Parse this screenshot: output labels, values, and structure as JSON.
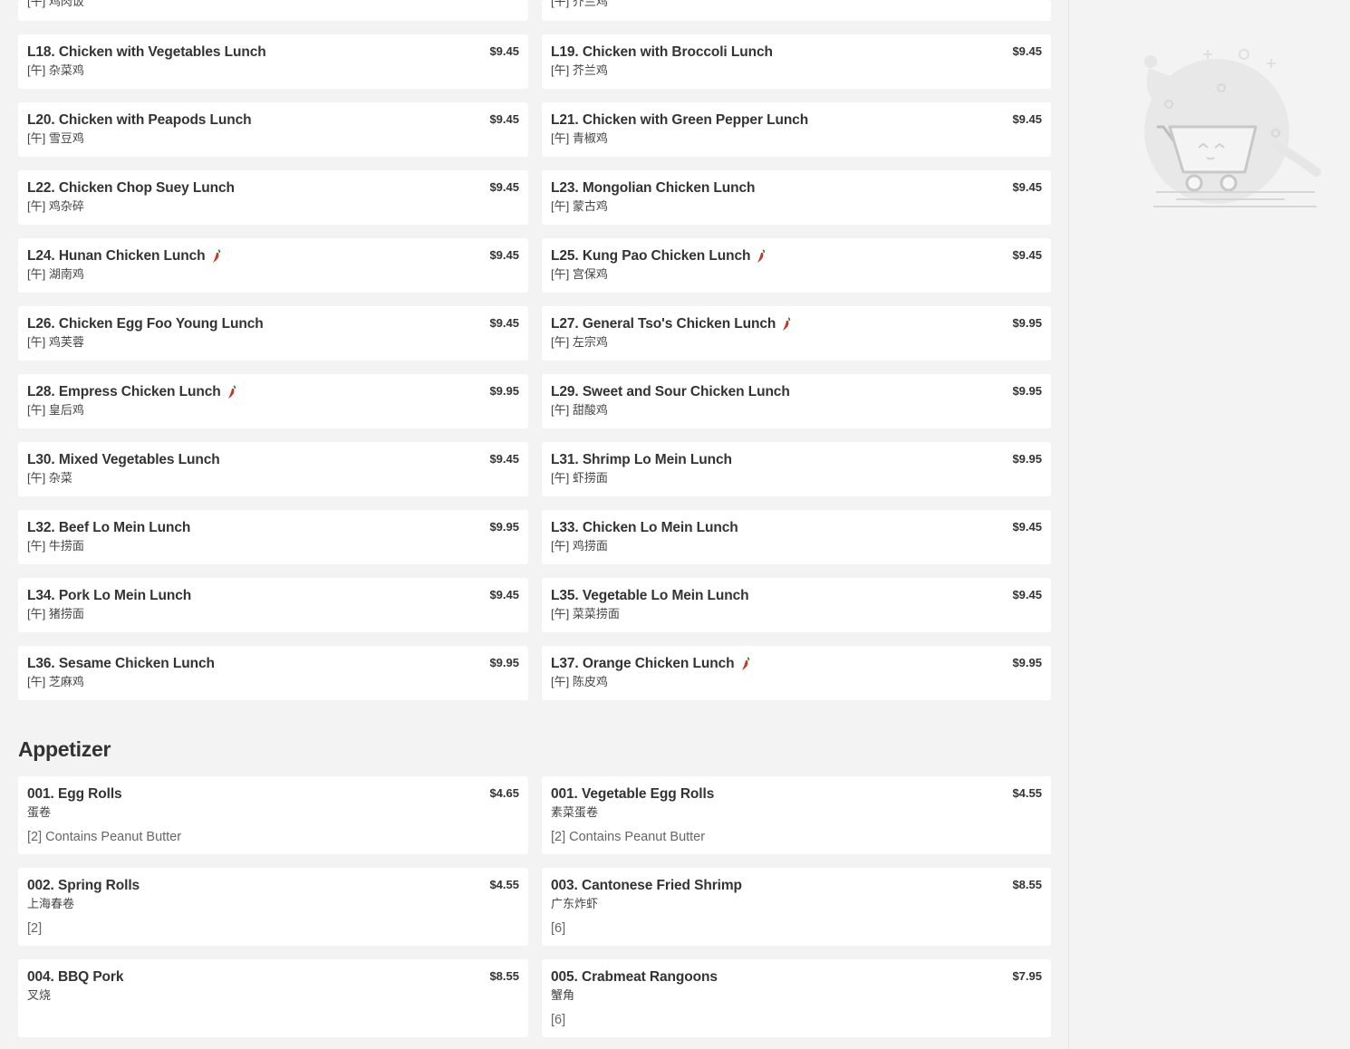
{
  "top_partial": [
    {
      "sub": "[午] 鸡肉饭"
    },
    {
      "sub": "[午] 芥兰鸡"
    }
  ],
  "lunch_items": [
    {
      "name": "L18. Chicken with Vegetables Lunch",
      "price": "$9.45",
      "sub": "[午] 杂菜鸡",
      "spicy": false
    },
    {
      "name": "L19. Chicken with Broccoli Lunch",
      "price": "$9.45",
      "sub": "[午] 芥兰鸡",
      "spicy": false
    },
    {
      "name": "L20. Chicken with Peapods Lunch",
      "price": "$9.45",
      "sub": "[午] 雪豆鸡",
      "spicy": false
    },
    {
      "name": "L21. Chicken with Green Pepper Lunch",
      "price": "$9.45",
      "sub": "[午] 青椒鸡",
      "spicy": false
    },
    {
      "name": "L22. Chicken Chop Suey Lunch",
      "price": "$9.45",
      "sub": "[午] 鸡杂碎",
      "spicy": false
    },
    {
      "name": "L23. Mongolian Chicken Lunch",
      "price": "$9.45",
      "sub": "[午] 蒙古鸡",
      "spicy": false
    },
    {
      "name": "L24. Hunan Chicken Lunch",
      "price": "$9.45",
      "sub": "[午] 湖南鸡",
      "spicy": true
    },
    {
      "name": "L25. Kung Pao Chicken Lunch",
      "price": "$9.45",
      "sub": "[午] 宫保鸡",
      "spicy": true
    },
    {
      "name": "L26. Chicken Egg Foo Young Lunch",
      "price": "$9.45",
      "sub": "[午] 鸡芙蓉",
      "spicy": false
    },
    {
      "name": "L27. General Tso's Chicken Lunch",
      "price": "$9.95",
      "sub": "[午] 左宗鸡",
      "spicy": true
    },
    {
      "name": "L28. Empress Chicken Lunch",
      "price": "$9.95",
      "sub": "[午] 皇后鸡",
      "spicy": true
    },
    {
      "name": "L29. Sweet and Sour Chicken Lunch",
      "price": "$9.95",
      "sub": "[午] 甜酸鸡",
      "spicy": false
    },
    {
      "name": "L30. Mixed Vegetables Lunch",
      "price": "$9.45",
      "sub": "[午] 杂菜",
      "spicy": false
    },
    {
      "name": "L31. Shrimp Lo Mein Lunch",
      "price": "$9.95",
      "sub": "[午] 虾捞面",
      "spicy": false
    },
    {
      "name": "L32. Beef Lo Mein Lunch",
      "price": "$9.95",
      "sub": "[午] 牛捞面",
      "spicy": false
    },
    {
      "name": "L33. Chicken Lo Mein Lunch",
      "price": "$9.45",
      "sub": "[午] 鸡捞面",
      "spicy": false
    },
    {
      "name": "L34. Pork Lo Mein Lunch",
      "price": "$9.45",
      "sub": "[午] 猪捞面",
      "spicy": false
    },
    {
      "name": "L35. Vegetable Lo Mein Lunch",
      "price": "$9.45",
      "sub": "[午] 菜菜捞面",
      "spicy": false
    },
    {
      "name": "L36. Sesame Chicken Lunch",
      "price": "$9.95",
      "sub": "[午] 芝麻鸡",
      "spicy": false
    },
    {
      "name": "L37. Orange Chicken Lunch",
      "price": "$9.95",
      "sub": "[午] 陈皮鸡",
      "spicy": true
    }
  ],
  "appetizer": {
    "title": "Appetizer",
    "items": [
      {
        "name": "001. Egg Rolls",
        "price": "$4.65",
        "sub": "蛋卷",
        "note": "[2] Contains Peanut Butter"
      },
      {
        "name": "001. Vegetable Egg Rolls",
        "price": "$4.55",
        "sub": "素菜蛋卷",
        "note": "[2] Contains Peanut Butter"
      },
      {
        "name": "002. Spring Rolls",
        "price": "$4.55",
        "sub": "上海春卷",
        "note": "[2]"
      },
      {
        "name": "003. Cantonese Fried Shrimp",
        "price": "$8.55",
        "sub": "广东炸虾",
        "note": "[6]"
      },
      {
        "name": "004. BBQ Pork",
        "price": "$8.55",
        "sub": "叉烧",
        "note": ""
      },
      {
        "name": "005. Crabmeat Rangoons",
        "price": "$7.95",
        "sub": "蟹角",
        "note": "[6]"
      }
    ]
  },
  "colors": {
    "background": "#f3f3f3",
    "card": "#ffffff",
    "text": "#333333",
    "chili": "#c0392b",
    "illustration": "#e3e3e3"
  },
  "icons": {
    "spicy": "chili-pepper-icon",
    "empty_cart": "empty-cart-illustration"
  }
}
